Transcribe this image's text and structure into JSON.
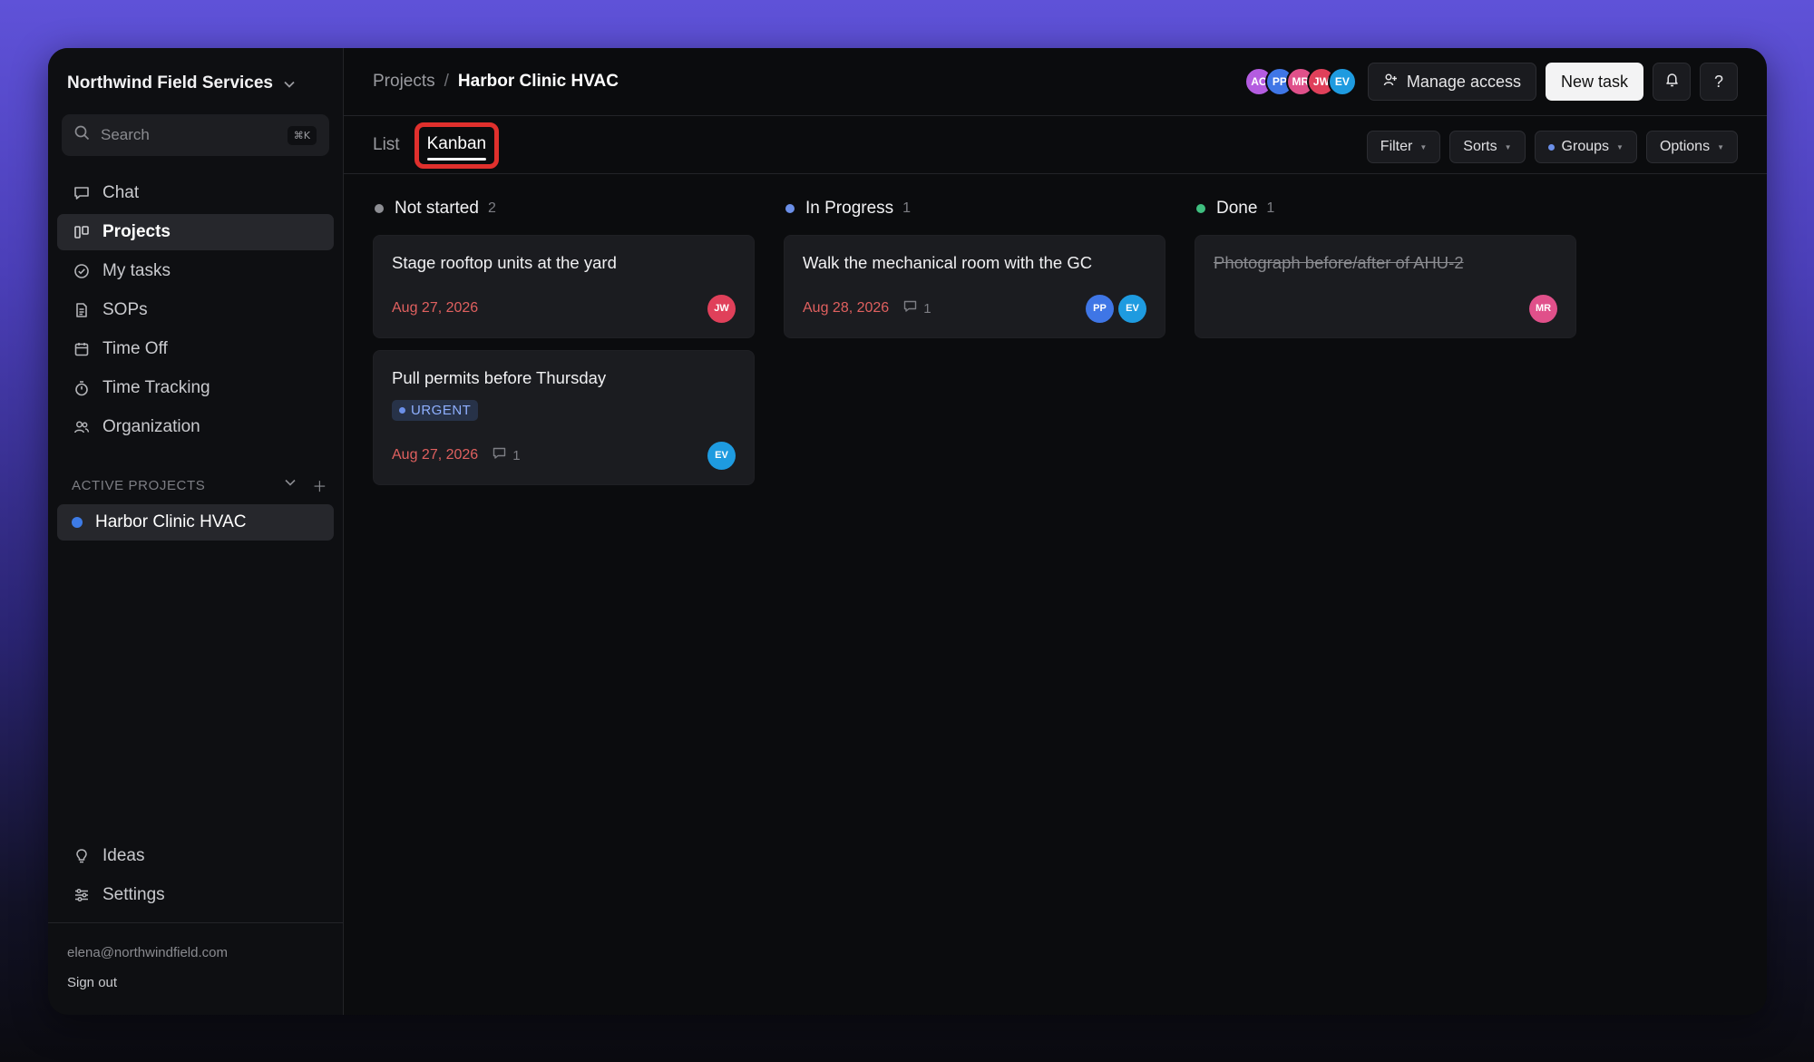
{
  "workspace": {
    "name": "Northwind Field Services"
  },
  "search": {
    "placeholder": "Search",
    "shortcut": "⌘K"
  },
  "nav": {
    "items": [
      {
        "label": "Chat",
        "icon": "chat-icon"
      },
      {
        "label": "Projects",
        "icon": "columns-icon",
        "active": true
      },
      {
        "label": "My tasks",
        "icon": "check-circle-icon"
      },
      {
        "label": "SOPs",
        "icon": "document-icon"
      },
      {
        "label": "Time Off",
        "icon": "calendar-icon"
      },
      {
        "label": "Time Tracking",
        "icon": "stopwatch-icon"
      },
      {
        "label": "Organization",
        "icon": "people-icon"
      }
    ],
    "bottom": [
      {
        "label": "Ideas",
        "icon": "lightbulb-icon"
      },
      {
        "label": "Settings",
        "icon": "sliders-icon"
      }
    ]
  },
  "active_projects": {
    "heading": "ACTIVE PROJECTS",
    "items": [
      {
        "label": "Harbor Clinic HVAC",
        "color": "#3d7be6"
      }
    ]
  },
  "user": {
    "email": "elena@northwindfield.com",
    "signout": "Sign out"
  },
  "breadcrumb": {
    "parent": "Projects",
    "separator": "/",
    "current": "Harbor Clinic HVAC"
  },
  "members": [
    {
      "initials": "AC",
      "color": "#b45ce0"
    },
    {
      "initials": "PP",
      "color": "#3f76e6"
    },
    {
      "initials": "MR",
      "color": "#e0508a"
    },
    {
      "initials": "JW",
      "color": "#e0405a"
    },
    {
      "initials": "EV",
      "color": "#1e9be0"
    }
  ],
  "actions": {
    "manage_access": "Manage access",
    "new_task": "New task",
    "help": "?"
  },
  "views": {
    "list": "List",
    "kanban": "Kanban"
  },
  "controls": {
    "filter": "Filter",
    "sorts": "Sorts",
    "groups": "Groups",
    "options": "Options"
  },
  "board": {
    "columns": [
      {
        "name": "Not started",
        "count": "2",
        "color": "#8d8e93",
        "cards": [
          {
            "title": "Stage rooftop units at the yard",
            "date": "Aug 27, 2026",
            "assignees": [
              {
                "initials": "JW",
                "color": "#e0405a"
              }
            ]
          },
          {
            "title": "Pull permits before Thursday",
            "tag": "URGENT",
            "date": "Aug 27, 2026",
            "comments": "1",
            "assignees": [
              {
                "initials": "EV",
                "color": "#1e9be0"
              }
            ]
          }
        ]
      },
      {
        "name": "In Progress",
        "count": "1",
        "color": "#6b8fe8",
        "cards": [
          {
            "title": "Walk the mechanical room with the GC",
            "date": "Aug 28, 2026",
            "comments": "1",
            "assignees": [
              {
                "initials": "PP",
                "color": "#3f76e6"
              },
              {
                "initials": "EV",
                "color": "#1e9be0"
              }
            ]
          }
        ]
      },
      {
        "name": "Done",
        "count": "1",
        "color": "#3fbf7f",
        "cards": [
          {
            "title": "Photograph before/after of AHU-2",
            "done": true,
            "assignees": [
              {
                "initials": "MR",
                "color": "#e0508a"
              }
            ]
          }
        ]
      }
    ]
  }
}
